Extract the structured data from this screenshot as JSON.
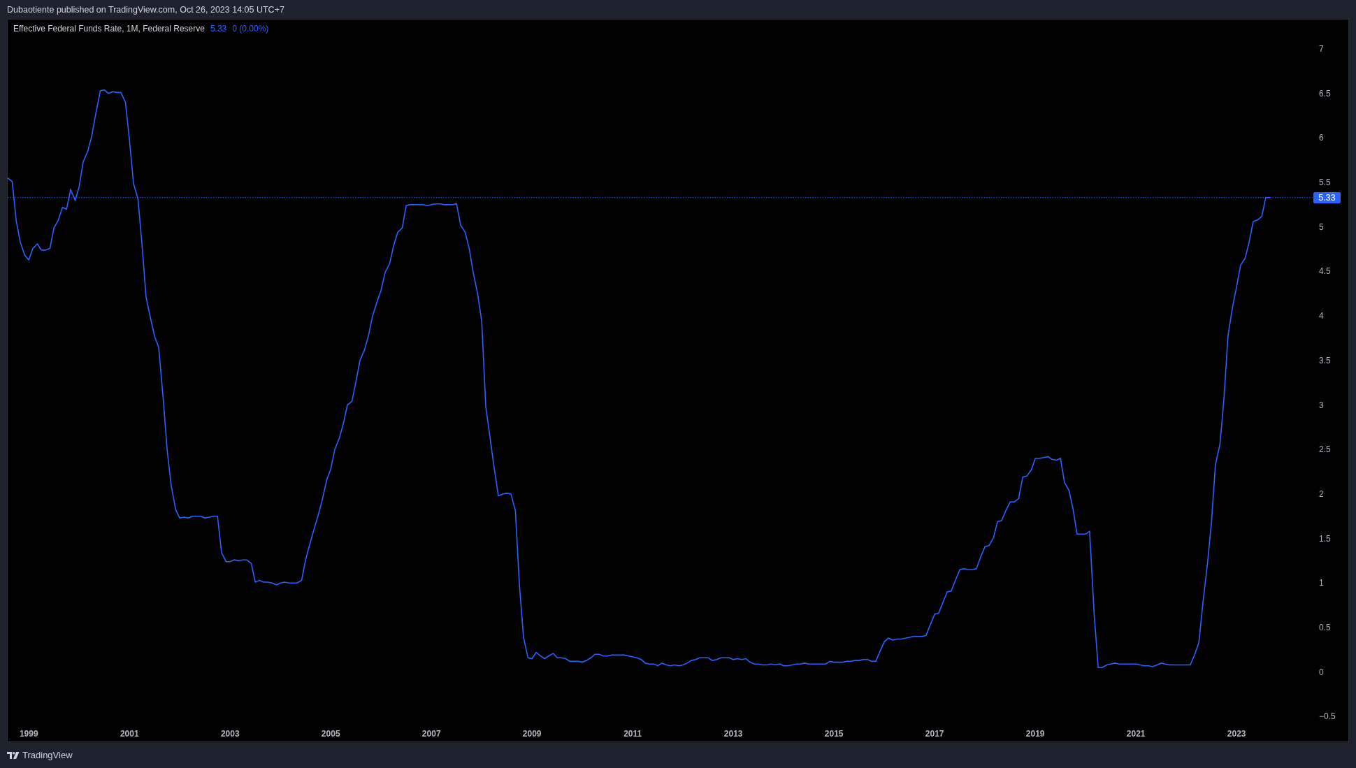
{
  "header": {
    "text": "Dubaotiente published on TradingView.com, Oct 26, 2023 14:05 UTC+7"
  },
  "legend": {
    "value": "5.33",
    "change": "0 (0.00%)"
  },
  "chart": {
    "price_label": "5.33",
    "chart_data": {
      "type": "line",
      "x": [
        1998.58,
        1998.67,
        1998.75,
        1998.83,
        1998.92,
        1999.0,
        1999.08,
        1999.17,
        1999.25,
        1999.33,
        1999.42,
        1999.5,
        1999.58,
        1999.67,
        1999.75,
        1999.83,
        1999.92,
        2000.0,
        2000.08,
        2000.17,
        2000.25,
        2000.33,
        2000.42,
        2000.5,
        2000.58,
        2000.67,
        2000.75,
        2000.83,
        2000.92,
        2001.0,
        2001.08,
        2001.17,
        2001.25,
        2001.33,
        2001.42,
        2001.5,
        2001.58,
        2001.67,
        2001.75,
        2001.83,
        2001.92,
        2002.0,
        2002.08,
        2002.17,
        2002.25,
        2002.33,
        2002.42,
        2002.5,
        2002.58,
        2002.67,
        2002.75,
        2002.83,
        2002.92,
        2003.0,
        2003.08,
        2003.17,
        2003.25,
        2003.33,
        2003.42,
        2003.5,
        2003.58,
        2003.67,
        2003.75,
        2003.83,
        2003.92,
        2004.0,
        2004.08,
        2004.17,
        2004.25,
        2004.33,
        2004.42,
        2004.5,
        2004.58,
        2004.67,
        2004.75,
        2004.83,
        2004.92,
        2005.0,
        2005.08,
        2005.17,
        2005.25,
        2005.33,
        2005.42,
        2005.5,
        2005.58,
        2005.67,
        2005.75,
        2005.83,
        2005.92,
        2006.0,
        2006.08,
        2006.17,
        2006.25,
        2006.33,
        2006.42,
        2006.5,
        2006.58,
        2006.67,
        2006.75,
        2006.83,
        2006.92,
        2007.0,
        2007.08,
        2007.17,
        2007.25,
        2007.33,
        2007.42,
        2007.5,
        2007.58,
        2007.67,
        2007.75,
        2007.83,
        2007.92,
        2008.0,
        2008.08,
        2008.17,
        2008.25,
        2008.33,
        2008.42,
        2008.5,
        2008.58,
        2008.67,
        2008.75,
        2008.83,
        2008.92,
        2009.0,
        2009.08,
        2009.17,
        2009.25,
        2009.33,
        2009.42,
        2009.5,
        2009.58,
        2009.67,
        2009.75,
        2009.83,
        2009.92,
        2010.0,
        2010.08,
        2010.17,
        2010.25,
        2010.33,
        2010.42,
        2010.5,
        2010.58,
        2010.67,
        2010.75,
        2010.83,
        2010.92,
        2011.0,
        2011.08,
        2011.17,
        2011.25,
        2011.33,
        2011.42,
        2011.5,
        2011.58,
        2011.67,
        2011.75,
        2011.83,
        2011.92,
        2012.0,
        2012.08,
        2012.17,
        2012.25,
        2012.33,
        2012.42,
        2012.5,
        2012.58,
        2012.67,
        2012.75,
        2012.83,
        2012.92,
        2013.0,
        2013.08,
        2013.17,
        2013.25,
        2013.33,
        2013.42,
        2013.5,
        2013.58,
        2013.67,
        2013.75,
        2013.83,
        2013.92,
        2014.0,
        2014.08,
        2014.17,
        2014.25,
        2014.33,
        2014.42,
        2014.5,
        2014.58,
        2014.67,
        2014.75,
        2014.83,
        2014.92,
        2015.0,
        2015.08,
        2015.17,
        2015.25,
        2015.33,
        2015.42,
        2015.5,
        2015.58,
        2015.67,
        2015.75,
        2015.83,
        2015.92,
        2016.0,
        2016.08,
        2016.17,
        2016.25,
        2016.33,
        2016.42,
        2016.5,
        2016.58,
        2016.67,
        2016.75,
        2016.83,
        2016.92,
        2017.0,
        2017.08,
        2017.17,
        2017.25,
        2017.33,
        2017.42,
        2017.5,
        2017.58,
        2017.67,
        2017.75,
        2017.83,
        2017.92,
        2018.0,
        2018.08,
        2018.17,
        2018.25,
        2018.33,
        2018.42,
        2018.5,
        2018.58,
        2018.67,
        2018.75,
        2018.83,
        2018.92,
        2019.0,
        2019.08,
        2019.17,
        2019.25,
        2019.33,
        2019.42,
        2019.5,
        2019.58,
        2019.67,
        2019.75,
        2019.83,
        2019.92,
        2020.0,
        2020.08,
        2020.17,
        2020.25,
        2020.33,
        2020.42,
        2020.5,
        2020.58,
        2020.67,
        2020.75,
        2020.83,
        2020.92,
        2021.0,
        2021.08,
        2021.17,
        2021.25,
        2021.33,
        2021.42,
        2021.5,
        2021.58,
        2021.67,
        2021.75,
        2021.83,
        2021.92,
        2022.0,
        2022.08,
        2022.17,
        2022.25,
        2022.33,
        2022.42,
        2022.5,
        2022.58,
        2022.67,
        2022.75,
        2022.83,
        2022.92,
        2023.0,
        2023.08,
        2023.17,
        2023.25,
        2023.33,
        2023.42,
        2023.5,
        2023.58,
        2023.67
      ],
      "xticks": [
        {
          "value": 1999,
          "label": "1999"
        },
        {
          "value": 2001,
          "label": "2001"
        },
        {
          "value": 2003,
          "label": "2003"
        },
        {
          "value": 2005,
          "label": "2005"
        },
        {
          "value": 2007,
          "label": "2007"
        },
        {
          "value": 2009,
          "label": "2009"
        },
        {
          "value": 2011,
          "label": "2011"
        },
        {
          "value": 2013,
          "label": "2013"
        },
        {
          "value": 2015,
          "label": "2015"
        },
        {
          "value": 2017,
          "label": "2017"
        },
        {
          "value": 2019,
          "label": "2019"
        },
        {
          "value": 2021,
          "label": "2021"
        },
        {
          "value": 2023,
          "label": "2023"
        }
      ],
      "yticks": [
        7,
        {
          "value": 6.5,
          "label": "6.5"
        },
        6,
        {
          "value": 5.5,
          "label": "5.5"
        },
        5,
        {
          "value": 4.5,
          "label": "4.5"
        },
        4,
        {
          "value": 3.5,
          "label": "3.5"
        },
        3,
        {
          "value": 2.5,
          "label": "2.5"
        },
        2,
        {
          "value": 1.5,
          "label": "1.5"
        },
        1,
        {
          "value": 0.5,
          "label": "0.5"
        },
        0,
        {
          "value": -0.5,
          "label": "−0.5"
        }
      ],
      "ref_lines": [
        {
          "axis": "y",
          "value": 5.33
        }
      ],
      "xlim": [
        1998.58,
        2025.22
      ],
      "ylim": [
        -0.78,
        7.33
      ],
      "series": [
        {
          "name": "Effective Federal Funds Rate, 1M, Federal Reserve",
          "color": "#2962ff",
          "values": [
            5.55,
            5.51,
            5.07,
            4.83,
            4.68,
            4.63,
            4.76,
            4.81,
            4.74,
            4.74,
            4.76,
            4.99,
            5.07,
            5.22,
            5.2,
            5.42,
            5.3,
            5.45,
            5.73,
            5.85,
            6.02,
            6.27,
            6.53,
            6.54,
            6.5,
            6.52,
            6.51,
            6.51,
            6.4,
            5.98,
            5.49,
            5.31,
            4.8,
            4.21,
            3.97,
            3.77,
            3.65,
            3.07,
            2.49,
            2.09,
            1.82,
            1.73,
            1.74,
            1.73,
            1.75,
            1.75,
            1.75,
            1.73,
            1.74,
            1.75,
            1.75,
            1.34,
            1.24,
            1.24,
            1.26,
            1.25,
            1.26,
            1.26,
            1.22,
            1.01,
            1.03,
            1.01,
            1.01,
            1.0,
            0.98,
            1.0,
            1.01,
            1.0,
            1.0,
            1.0,
            1.03,
            1.26,
            1.43,
            1.61,
            1.76,
            1.93,
            2.16,
            2.28,
            2.5,
            2.63,
            2.79,
            3.0,
            3.04,
            3.26,
            3.5,
            3.62,
            3.78,
            4.0,
            4.16,
            4.29,
            4.49,
            4.59,
            4.79,
            4.94,
            4.99,
            5.24,
            5.25,
            5.25,
            5.25,
            5.25,
            5.24,
            5.25,
            5.26,
            5.26,
            5.25,
            5.25,
            5.25,
            5.26,
            5.02,
            4.94,
            4.76,
            4.49,
            4.24,
            3.94,
            2.98,
            2.61,
            2.28,
            1.98,
            2.0,
            2.01,
            2.0,
            1.81,
            0.97,
            0.39,
            0.16,
            0.15,
            0.22,
            0.18,
            0.15,
            0.18,
            0.21,
            0.16,
            0.16,
            0.15,
            0.12,
            0.12,
            0.12,
            0.11,
            0.13,
            0.16,
            0.2,
            0.2,
            0.18,
            0.18,
            0.19,
            0.19,
            0.19,
            0.19,
            0.18,
            0.17,
            0.16,
            0.14,
            0.1,
            0.09,
            0.09,
            0.07,
            0.1,
            0.08,
            0.07,
            0.08,
            0.07,
            0.08,
            0.1,
            0.13,
            0.14,
            0.16,
            0.16,
            0.16,
            0.13,
            0.14,
            0.16,
            0.16,
            0.16,
            0.14,
            0.15,
            0.14,
            0.15,
            0.11,
            0.09,
            0.09,
            0.08,
            0.08,
            0.09,
            0.08,
            0.09,
            0.07,
            0.07,
            0.08,
            0.09,
            0.09,
            0.1,
            0.09,
            0.09,
            0.09,
            0.09,
            0.09,
            0.12,
            0.11,
            0.11,
            0.11,
            0.12,
            0.12,
            0.13,
            0.13,
            0.14,
            0.14,
            0.12,
            0.12,
            0.24,
            0.34,
            0.38,
            0.36,
            0.37,
            0.37,
            0.38,
            0.39,
            0.4,
            0.4,
            0.4,
            0.41,
            0.54,
            0.65,
            0.66,
            0.79,
            0.9,
            0.91,
            1.04,
            1.15,
            1.16,
            1.15,
            1.15,
            1.16,
            1.3,
            1.41,
            1.42,
            1.51,
            1.69,
            1.7,
            1.82,
            1.91,
            1.91,
            1.95,
            2.19,
            2.2,
            2.27,
            2.4,
            2.4,
            2.41,
            2.42,
            2.39,
            2.38,
            2.4,
            2.13,
            2.04,
            1.83,
            1.55,
            1.55,
            1.55,
            1.58,
            0.65,
            0.05,
            0.05,
            0.08,
            0.09,
            0.1,
            0.09,
            0.09,
            0.09,
            0.09,
            0.09,
            0.08,
            0.07,
            0.07,
            0.06,
            0.08,
            0.1,
            0.09,
            0.08,
            0.08,
            0.08,
            0.08,
            0.08,
            0.08,
            0.2,
            0.33,
            0.77,
            1.21,
            1.68,
            2.33,
            2.56,
            3.08,
            3.78,
            4.1,
            4.33,
            4.57,
            4.65,
            4.83,
            5.06,
            5.08,
            5.12,
            5.33,
            5.33
          ]
        }
      ]
    }
  },
  "footer": {
    "brand": "TradingView"
  }
}
